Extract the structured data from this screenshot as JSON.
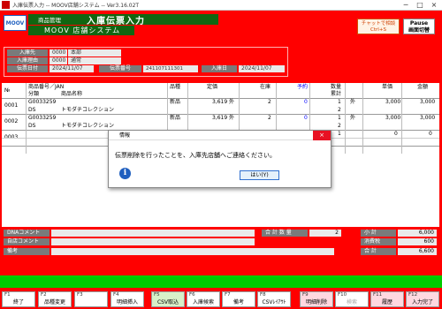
{
  "window": {
    "title": "入庫伝票入力 -- MOOV店舗システム -- Ver3.16.02T",
    "controls": [
      "─",
      "□",
      "×"
    ]
  },
  "header": {
    "logo": "MOOV",
    "menu": "商品管理",
    "screen_title": "入庫伝票入力",
    "system_name": "MOOV 店舗システム",
    "chat_button": "チャットで相談",
    "chat_hint": "Ctrl+S",
    "pause_line1": "Pause",
    "pause_line2": "画面切替"
  },
  "info": {
    "supplier_label": "入庫先",
    "supplier_code": "0000",
    "supplier_name": "本部",
    "reason_label": "入庫理由",
    "reason_code": "0000",
    "reason_name": "通常",
    "date_label": "伝票日付",
    "date_value": "2024/11/07",
    "slip_label": "伝票番号",
    "slip_value": "241107111301",
    "in_date_label": "入庫日",
    "in_date_value": "2024/11/07"
  },
  "table": {
    "headers": {
      "no": "№",
      "code": "商品番号／JAN",
      "category": "分類",
      "name": "商品名称",
      "grade": "品種",
      "price": "定価",
      "stock": "在庫",
      "reserve": "予約",
      "qty": "数量",
      "cum": "累計",
      "unit": "単価",
      "amount": "金額"
    },
    "rows": [
      {
        "no": "0001",
        "code": "G0033259",
        "grade": "新品",
        "price": "3,619",
        "tax": "外",
        "stock": "2",
        "reserve": "0",
        "qty": "1",
        "cum": "2",
        "tax2": "外",
        "unit": "3,000",
        "amount": "3,000",
        "category": "DS",
        "name": "トモダチコレクション"
      },
      {
        "no": "0002",
        "code": "G0033259",
        "grade": "新品",
        "price": "3,619",
        "tax": "外",
        "stock": "2",
        "reserve": "0",
        "qty": "1",
        "cum": "2",
        "tax2": "外",
        "unit": "3,000",
        "amount": "3,000",
        "category": "DS",
        "name": "トモダチコレクション"
      },
      {
        "no": "0003",
        "code": "",
        "grade": "",
        "price": "",
        "tax": "",
        "stock": "",
        "reserve": "",
        "qty": "1",
        "cum": "",
        "tax2": "",
        "unit": "0",
        "amount": "0",
        "category": "",
        "name": ""
      }
    ]
  },
  "dialog": {
    "title": "情報",
    "close": "×",
    "message": "伝票削除を行ったことを、入庫先店舗へご連絡ください。",
    "icon_glyph": "i",
    "ok_label": "はい(Y)"
  },
  "summary": {
    "dna_label": "DNAコメント",
    "store_label": "自店コメント",
    "note_label": "備考",
    "total_qty_label": "合 計 数 量",
    "total_qty": "2",
    "subtotal_label": "小 計",
    "subtotal": "6,000",
    "tax_label": "消費税",
    "tax": "600",
    "total_label": "合 計",
    "total": "6,600"
  },
  "fkeys": [
    {
      "key": "F1",
      "label": "終了",
      "style": ""
    },
    {
      "key": "F2",
      "label": "品種変更",
      "style": ""
    },
    {
      "key": "F3",
      "label": "",
      "style": ""
    },
    {
      "key": "F4",
      "label": "明細挿入",
      "style": ""
    },
    {
      "key": "F5",
      "label": "CSV取込",
      "style": "green"
    },
    {
      "key": "F6",
      "label": "入庫候索",
      "style": ""
    },
    {
      "key": "F7",
      "label": "備考",
      "style": ""
    },
    {
      "key": "F8",
      "label": "CSVﾚｲｱｳﾄ",
      "style": ""
    },
    {
      "key": "F9",
      "label": "明細削除",
      "style": "pink"
    },
    {
      "key": "F10",
      "label": "検索",
      "style": "dis"
    },
    {
      "key": "F11",
      "label": "履歴",
      "style": "pink"
    },
    {
      "key": "F12",
      "label": "入力完了",
      "style": "pink"
    }
  ]
}
